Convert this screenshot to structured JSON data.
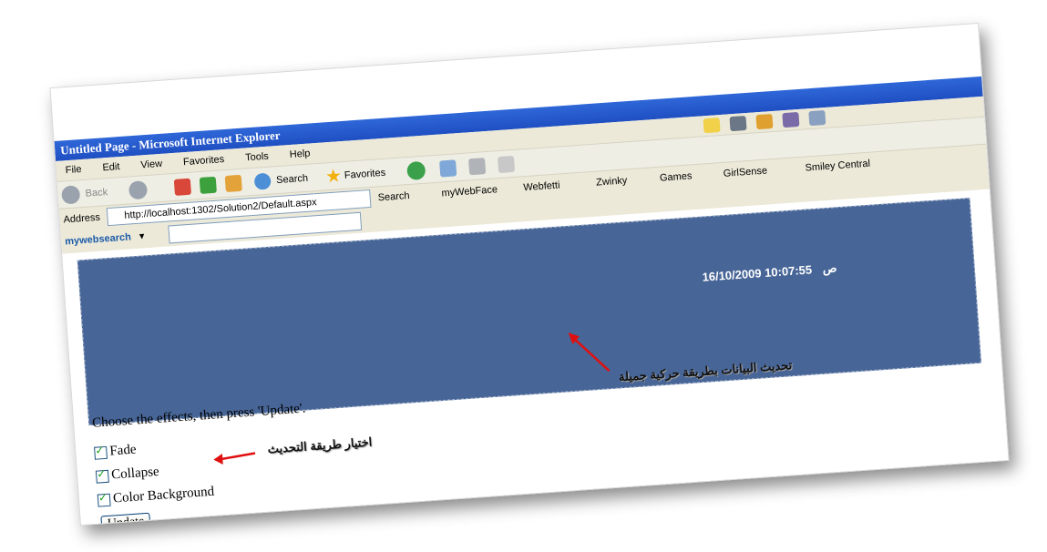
{
  "window": {
    "title": "Untitled Page - Microsoft Internet Explorer"
  },
  "menu": [
    "File",
    "Edit",
    "View",
    "Favorites",
    "Tools",
    "Help"
  ],
  "toolbar": {
    "back": "Back",
    "search": "Search",
    "favorites": "Favorites"
  },
  "address": {
    "label": "Address",
    "url": "http://localhost:1302/Solution2/Default.aspx"
  },
  "searchbar": {
    "brand": "mywebsearch",
    "search": "Search",
    "links": [
      "myWebFace",
      "Webfetti",
      "Zwinky",
      "Games",
      "GirlSense",
      "Smiley Central"
    ]
  },
  "page": {
    "clock_ampm": "ص",
    "clock_text": "16/10/2009 10:07:55",
    "annotation_update": "تحديث البيانات بطريقة حركية جميلة",
    "annotation_choose": "اختيار طريقة التحديث",
    "instruction": "Choose the effects, then press 'Update'.",
    "checkboxes": [
      "Fade",
      "Collapse",
      "Color Background"
    ],
    "update_button": "Update"
  },
  "colors": {
    "panel": "#476596",
    "arrow": "#e01010",
    "titlebar": "#2f67d8"
  }
}
